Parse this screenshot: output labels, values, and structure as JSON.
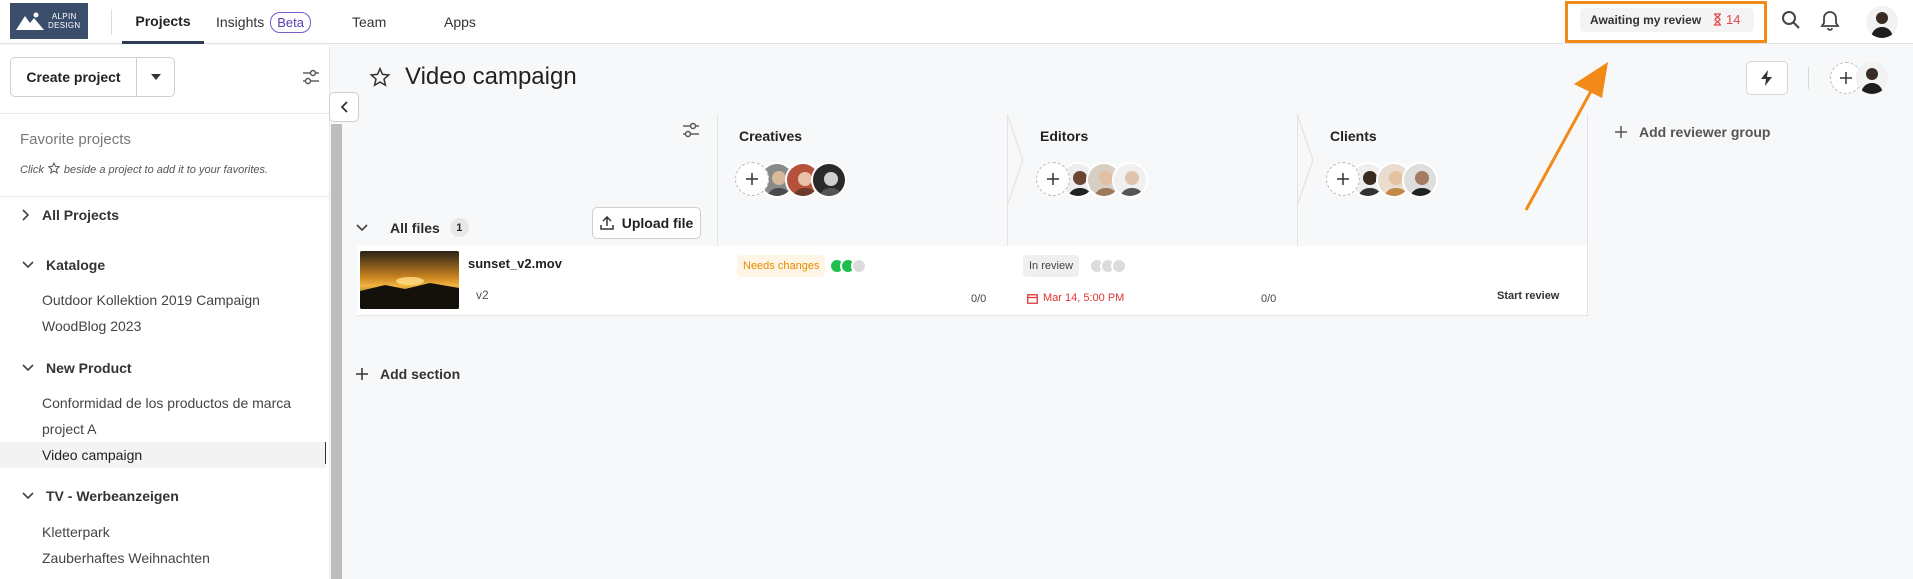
{
  "app": {
    "logo_text_line1": "ALPIN",
    "logo_text_line2": "DESIGN",
    "nav": [
      {
        "label": "Projects",
        "active": true
      },
      {
        "label": "Insights",
        "badge": "Beta"
      },
      {
        "label": "Team"
      },
      {
        "label": "Apps"
      }
    ],
    "awaiting_label": "Awaiting my review",
    "awaiting_count": "14",
    "accent_color": "#f28a1a"
  },
  "sidebar": {
    "create_label": "Create project",
    "favorites_title": "Favorite projects",
    "favorites_hint_before": "Click",
    "favorites_hint_after": "beside a project to add it to your favorites.",
    "all_projects": "All Projects",
    "groups": [
      {
        "label": "Kataloge",
        "items": [
          "Outdoor Kollektion 2019 Campaign",
          "WoodBlog 2023"
        ]
      },
      {
        "label": "New Product",
        "items": [
          "Conformidad de los productos de marca",
          "project A",
          "Video campaign"
        ]
      },
      {
        "label": "TV - Werbeanzeigen",
        "items": [
          "Kletterpark",
          "Zauberhaftes Weihnachten"
        ]
      }
    ]
  },
  "main": {
    "title": "Video campaign",
    "all_files_label": "All files",
    "file_count": "1",
    "upload_label": "Upload file",
    "add_reviewer_group": "Add reviewer group",
    "add_section": "Add section",
    "stages": [
      {
        "name": "Creatives"
      },
      {
        "name": "Editors"
      },
      {
        "name": "Clients"
      }
    ],
    "file": {
      "name": "sunset_v2.mov",
      "version": "v2",
      "creatives_status": "Needs changes",
      "creatives_progress": "0/0",
      "editors_status": "In review",
      "editors_due": "Mar 14, 5:00 PM",
      "editors_progress": "0/0",
      "clients_action": "Start review"
    }
  }
}
